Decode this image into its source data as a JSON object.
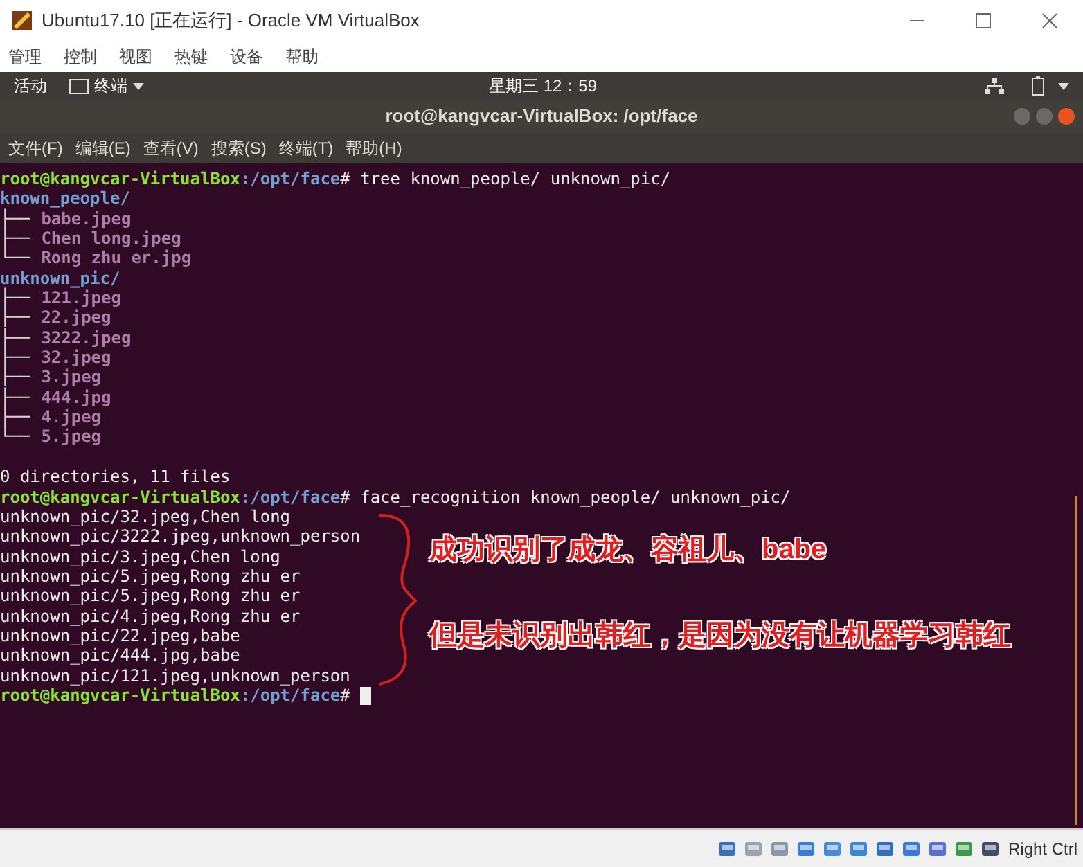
{
  "window": {
    "title": "Ubuntu17.10 [正在运行] - Oracle VM VirtualBox"
  },
  "menu": [
    "管理",
    "控制",
    "视图",
    "热键",
    "设备",
    "帮助"
  ],
  "top_bar": {
    "activities": "活动",
    "app": "终端",
    "clock": "星期三 12：59"
  },
  "terminal": {
    "title": "root@kangvcar-VirtualBox: /opt/face",
    "menu": [
      "文件(F)",
      "编辑(E)",
      "查看(V)",
      "搜索(S)",
      "终端(T)",
      "帮助(H)"
    ],
    "lines": [
      {
        "kind": "prompt",
        "user": "root@kangvcar-VirtualBox",
        "path": ":/opt/face",
        "command": "# tree known_people/ unknown_pic/"
      },
      {
        "kind": "tree",
        "name": "known_people/",
        "children": [
          {
            "branch": "├──",
            "name": "babe.jpeg"
          },
          {
            "branch": "├──",
            "name": "Chen long.jpeg"
          },
          {
            "branch": "└──",
            "name": "Rong zhu er.jpg"
          }
        ]
      },
      {
        "kind": "tree",
        "name": "unknown_pic/",
        "children": [
          {
            "branch": "├──",
            "name": "121.jpeg"
          },
          {
            "branch": "├──",
            "name": "22.jpeg"
          },
          {
            "branch": "├──",
            "name": "3222.jpeg"
          },
          {
            "branch": "├──",
            "name": "32.jpeg"
          },
          {
            "branch": "├──",
            "name": "3.jpeg"
          },
          {
            "branch": "├──",
            "name": "444.jpg"
          },
          {
            "branch": "├──",
            "name": "4.jpeg"
          },
          {
            "branch": "└──",
            "name": "5.jpeg"
          }
        ]
      },
      {
        "kind": "blank"
      },
      {
        "kind": "output",
        "text": "0 directories, 11 files"
      },
      {
        "kind": "prompt",
        "user": "root@kangvcar-VirtualBox",
        "path": ":/opt/face",
        "command": "# face_recognition known_people/ unknown_pic/"
      },
      {
        "kind": "output",
        "text": "unknown_pic/32.jpeg,Chen long"
      },
      {
        "kind": "output",
        "text": "unknown_pic/3222.jpeg,unknown_person"
      },
      {
        "kind": "output",
        "text": "unknown_pic/3.jpeg,Chen long"
      },
      {
        "kind": "output",
        "text": "unknown_pic/5.jpeg,Rong zhu er"
      },
      {
        "kind": "output",
        "text": "unknown_pic/5.jpeg,Rong zhu er"
      },
      {
        "kind": "output",
        "text": "unknown_pic/4.jpeg,Rong zhu er"
      },
      {
        "kind": "output",
        "text": "unknown_pic/22.jpeg,babe"
      },
      {
        "kind": "output",
        "text": "unknown_pic/444.jpg,babe"
      },
      {
        "kind": "output",
        "text": "unknown_pic/121.jpeg,unknown_person"
      },
      {
        "kind": "prompt",
        "user": "root@kangvcar-VirtualBox",
        "path": ":/opt/face",
        "command": "#",
        "cursor": true
      }
    ]
  },
  "annotations": [
    "成功识别了成龙、容祖儿、babe",
    "但是未识别出韩红，是因为没有让机器学习韩红"
  ],
  "status_bar": {
    "host_key": "Right Ctrl"
  }
}
